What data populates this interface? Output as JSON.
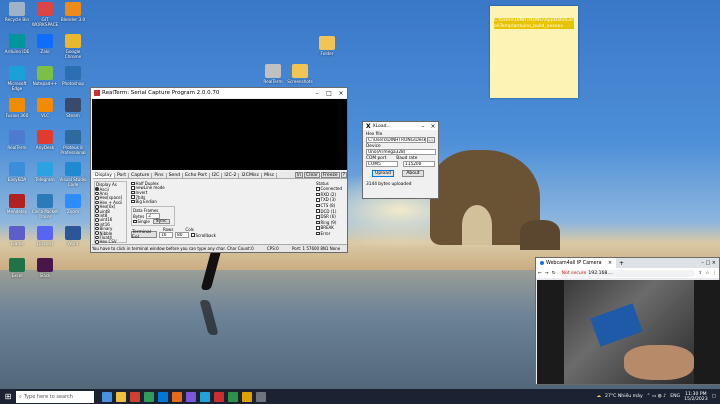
{
  "desktop_icons": [
    {
      "label": "Recycle Bin",
      "color": "#9fb3c8"
    },
    {
      "label": "GIT WORKSPACE",
      "color": "#d44"
    },
    {
      "label": "Blender 3.0",
      "color": "#ec8a1a"
    },
    {
      "label": "Arduino IDE",
      "color": "#00979c"
    },
    {
      "label": "Zalo",
      "color": "#0d6efd"
    },
    {
      "label": "Google Chrome",
      "color": "#e9b82c"
    },
    {
      "label": "Microsoft Edge",
      "color": "#1aa1d6"
    },
    {
      "label": "Notepad++",
      "color": "#7bc043"
    },
    {
      "label": "Photoshop",
      "color": "#2b6fb3"
    },
    {
      "label": "Fusion 360",
      "color": "#f08c00"
    },
    {
      "label": "VLC",
      "color": "#f48a00"
    },
    {
      "label": "Steam",
      "color": "#3a4a6a"
    },
    {
      "label": "RealTerm",
      "color": "#4c7bd0"
    },
    {
      "label": "AnyDesk",
      "color": "#e23b2e"
    },
    {
      "label": "Proteus 8 Professional",
      "color": "#2e6a9c"
    },
    {
      "label": "EasyEDA",
      "color": "#3a8fd8"
    },
    {
      "label": "Telegram",
      "color": "#2aa3e0"
    },
    {
      "label": "Visual Studio Code",
      "color": "#1f8ad2"
    },
    {
      "label": "Mendeley",
      "color": "#b0221d"
    },
    {
      "label": "Cisco Packet Tracer",
      "color": "#2b7bb9"
    },
    {
      "label": "Zoom",
      "color": "#2d8cff"
    },
    {
      "label": "Teams",
      "color": "#5b5fc7"
    },
    {
      "label": "Discord",
      "color": "#5865f2"
    },
    {
      "label": "Word",
      "color": "#2b579a"
    },
    {
      "label": "Excel",
      "color": "#217346"
    },
    {
      "label": "Slack",
      "color": "#4a154b"
    }
  ],
  "extra_icons": [
    {
      "label": "RealTerm",
      "color": "#c0c0c0"
    },
    {
      "label": "Screenshots",
      "color": "#f1c453"
    },
    {
      "label": "Folder",
      "color": "#f1c453"
    }
  ],
  "sticky_note": {
    "text": "C:\\Users\\DINHTRONG\\AppData\\Local\\Temp\\arduino_build_xxxxxx"
  },
  "realterm": {
    "title": "RealTerm: Serial Capture Program 2.0.0.70",
    "tabs": [
      "Display",
      "Port",
      "Capture",
      "Pins",
      "Send",
      "Echo Port",
      "I2C",
      "I2C-2",
      "I2CMisc",
      "Misc"
    ],
    "right_buttons": [
      "\\n",
      "Clear",
      "Freeze",
      "?"
    ],
    "display_as_label": "Display As",
    "display_as": [
      "Ascii",
      "Ansi",
      "Hex[space]",
      "Hex + Ascii",
      "Hex[0x]",
      "uint8",
      "int8",
      "uint16",
      "int16",
      "Binary",
      "Nibble",
      "Float4",
      "Hex CSV"
    ],
    "options": [
      "Half Duplex",
      "newLine mode",
      "Invert",
      "7bits",
      "Big Endian"
    ],
    "data_frames_label": "Data Frames",
    "bytes_label": "Bytes",
    "bytes_value": "2",
    "single_label": "Single",
    "sync_label": "Sync",
    "rows_label": "Rows",
    "cols_label": "Cols",
    "rows_value": "16",
    "cols_value": "80",
    "scrollback_label": "Scrollback",
    "terminal_eol_label": "Terminal Eol",
    "status_label": "Status",
    "status_items": [
      "Connected",
      "RXD (2)",
      "TXD (3)",
      "CTS (8)",
      "DCD (1)",
      "DSR (6)",
      "Ring (9)",
      "BREAK",
      "Error"
    ],
    "statusbar_left": "You have to click in terminal window before you can type any char. Char Count:0",
    "statusbar_cps": "CPS:0",
    "statusbar_port": "Port: 1 57600 8N1 None"
  },
  "xloader": {
    "title": "XLoad...",
    "hex_file_label": "Hex file",
    "hex_file_value": "C:\\Users\\DINHTRONG\\Deskt",
    "browse": "...",
    "device_label": "Device",
    "device_value": "Uno(ATmega328)",
    "com_port_label": "COM port",
    "baud_label": "Baud rate",
    "com_port_value": "COM5",
    "baud_value": "115200",
    "upload": "Upload",
    "about": "About",
    "status": "3144 bytes uploaded"
  },
  "webcam": {
    "tab_title": "Webcam4all IP Camera",
    "url_prefix": "Not secure",
    "url": "192.168....",
    "bar_color": "#0b8a3a"
  },
  "taskbar": {
    "search_placeholder": "Type here to search",
    "weather": "27°C Nhiều mây",
    "lang": "ENG",
    "time": "11:30 PM",
    "date": "15/2/2023"
  }
}
